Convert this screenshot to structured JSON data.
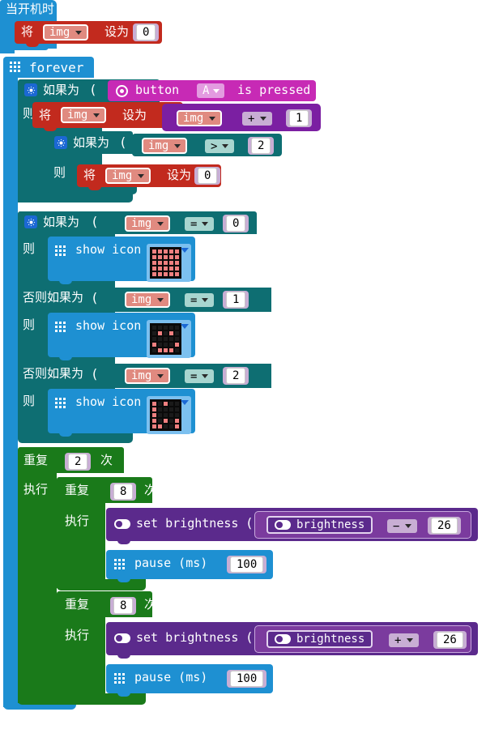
{
  "editor": {
    "name": "makecode-blocks-workspace",
    "language": "zh-CN-mixed"
  },
  "colors": {
    "event_blue": "#1e90d2",
    "loop_green": "#1a7a1a",
    "logic_teal": "#0e6e72",
    "variable_red": "#c22a1e",
    "math_purple": "#7b1fa2",
    "basic_blue": "#1e90d2",
    "led_purple": "#5b2a8c",
    "input_magenta": "#c72ab5",
    "socket_lavender": "#c8aed4",
    "compare_mint": "#a8d5cf"
  },
  "blocks": {
    "on_start": {
      "label": "当开机时"
    },
    "set_img_start": {
      "set_word": "将",
      "var": "img",
      "to_word": "设为",
      "value": "0"
    },
    "forever": {
      "label": "forever",
      "icon": "grid-dots-icon"
    },
    "if_button": {
      "if_word": "如果为",
      "then_word": "则",
      "condition": {
        "icon": "radio-dot-icon",
        "prefix": "button",
        "button": "A",
        "suffix": "is pressed"
      }
    },
    "set_img_increment": {
      "set_word": "将",
      "var": "img",
      "to_word": "设为",
      "expr": {
        "left": "img",
        "op": "+",
        "right": "1"
      }
    },
    "if_img_gt": {
      "if_word": "如果为",
      "then_word": "则",
      "condition": {
        "left": "img",
        "op": ">",
        "right": "2"
      },
      "body": {
        "set_word": "将",
        "var": "img",
        "to_word": "设为",
        "value": "0"
      }
    },
    "if_chain": {
      "if_word": "如果为",
      "then_word": "则",
      "elseif_word": "否则如果为",
      "branches": [
        {
          "left": "img",
          "op": "=",
          "right": "0",
          "action": "show icon",
          "icon_name": "led-icon-full-grid"
        },
        {
          "left": "img",
          "op": "=",
          "right": "1",
          "action": "show icon",
          "icon_name": "led-icon-smile"
        },
        {
          "left": "img",
          "op": "=",
          "right": "2",
          "action": "show icon",
          "icon_name": "led-icon-pattern"
        }
      ]
    },
    "repeat_outer": {
      "repeat_word": "重复",
      "times": "2",
      "times_word": "次",
      "do_word": "执行"
    },
    "repeat_inner_1": {
      "repeat_word": "重复",
      "times": "8",
      "times_word": "次",
      "do_word": "执行"
    },
    "set_brightness_down": {
      "label": "set brightness",
      "icon": "brightness-toggle-icon",
      "expr": {
        "left_label": "brightness",
        "op": "−",
        "right": "26"
      }
    },
    "pause_1": {
      "label": "pause (ms)",
      "icon": "grid-dots-icon",
      "value": "100"
    },
    "repeat_inner_2": {
      "repeat_word": "重复",
      "times": "8",
      "times_word": "次",
      "do_word": "执行"
    },
    "set_brightness_up": {
      "label": "set brightness",
      "icon": "brightness-toggle-icon",
      "expr": {
        "left_label": "brightness",
        "op": "+",
        "right": "26"
      }
    },
    "pause_2": {
      "label": "pause (ms)",
      "icon": "grid-dots-icon",
      "value": "100"
    }
  },
  "led_patterns": {
    "full_grid": [
      [
        1,
        1,
        1,
        1,
        1
      ],
      [
        1,
        1,
        1,
        1,
        1
      ],
      [
        1,
        1,
        1,
        1,
        1
      ],
      [
        1,
        1,
        1,
        1,
        1
      ],
      [
        1,
        1,
        1,
        1,
        1
      ]
    ],
    "smile": [
      [
        0,
        0,
        0,
        0,
        0
      ],
      [
        0,
        1,
        0,
        1,
        0
      ],
      [
        0,
        0,
        0,
        0,
        0
      ],
      [
        1,
        0,
        0,
        0,
        1
      ],
      [
        0,
        1,
        1,
        1,
        0
      ]
    ],
    "pattern": [
      [
        1,
        0,
        1,
        0,
        0
      ],
      [
        1,
        0,
        0,
        0,
        0
      ],
      [
        1,
        0,
        0,
        0,
        0
      ],
      [
        1,
        0,
        1,
        0,
        1
      ],
      [
        1,
        1,
        0,
        0,
        1
      ]
    ]
  }
}
